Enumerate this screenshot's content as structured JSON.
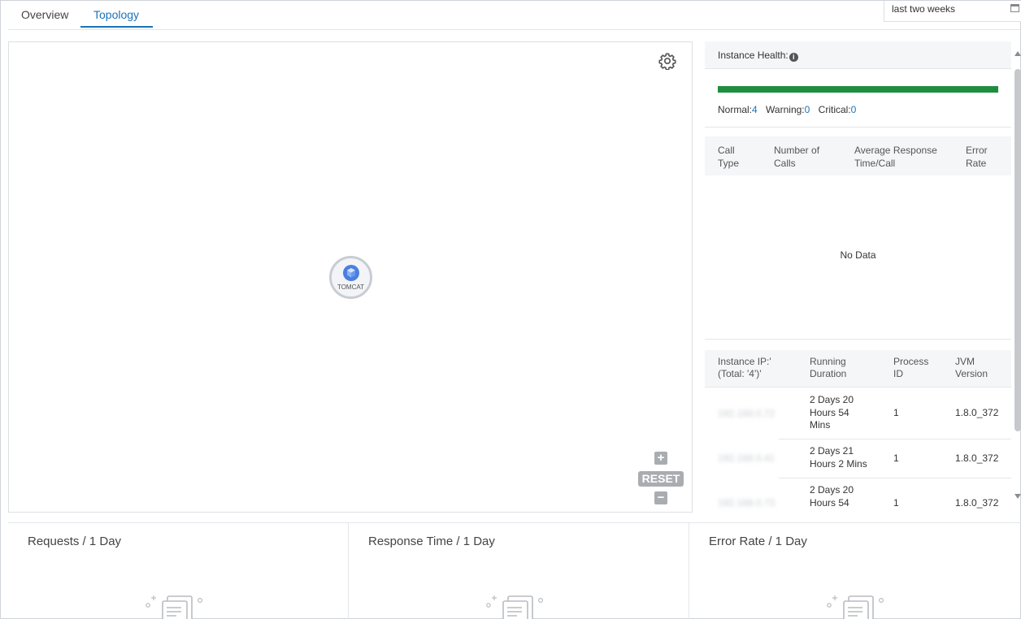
{
  "tabs": [
    {
      "label": "Overview",
      "active": false
    },
    {
      "label": "Topology",
      "active": true
    }
  ],
  "accent_color": "#1a73b8",
  "date_range": {
    "value": "last two weeks",
    "icon": "calendar-icon"
  },
  "topology": {
    "settings_icon": "gear-icon",
    "node": {
      "label": "TOMCAT",
      "icon": "cube-icon"
    },
    "zoom_in": "+",
    "reset": "RESET",
    "zoom_out": "−"
  },
  "health": {
    "title": "Instance Health:",
    "info_icon": "info-icon",
    "bar_color": "#1e8e3e",
    "normal_label": "Normal:",
    "normal": "4",
    "warning_label": "Warning:",
    "warning": "0",
    "critical_label": "Critical:",
    "critical": "0"
  },
  "call_table": {
    "headers": [
      [
        "Call",
        "Type"
      ],
      [
        "Number of",
        "Calls"
      ],
      [
        "Average Response",
        "Time/Call"
      ],
      [
        "Error",
        "Rate"
      ]
    ],
    "empty_text": "No Data"
  },
  "instance_table": {
    "headers": [
      [
        "Instance IP:'",
        "(Total: '4')'"
      ],
      [
        "Running",
        "Duration"
      ],
      [
        "Process",
        "ID"
      ],
      [
        "JVM",
        "Version"
      ]
    ],
    "rows": [
      {
        "ip": "192.168.0.72",
        "duration": [
          "2 Days 20",
          "Hours 54",
          "Mins"
        ],
        "pid": "1",
        "jvm": "1.8.0_372"
      },
      {
        "ip": "192.168.0.41",
        "duration": [
          "2 Days 21",
          "Hours 2 Mins"
        ],
        "pid": "1",
        "jvm": "1.8.0_372"
      },
      {
        "ip": "192.168.0.73",
        "duration": [
          "2 Days 20",
          "Hours 54"
        ],
        "pid": "1",
        "jvm": "1.8.0_372"
      }
    ]
  },
  "cards": [
    {
      "title": "Requests / 1 Day",
      "icon": "empty-data-icon"
    },
    {
      "title": "Response Time / 1 Day",
      "icon": "empty-data-icon"
    },
    {
      "title": "Error Rate / 1 Day",
      "icon": "empty-data-icon"
    }
  ]
}
